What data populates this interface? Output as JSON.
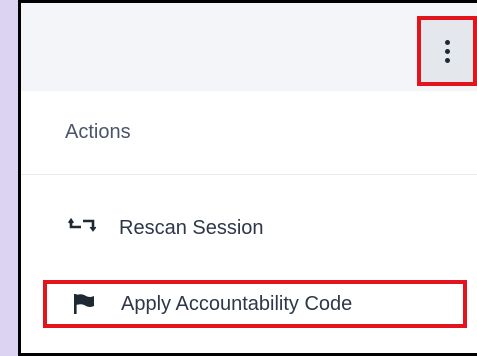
{
  "menu": {
    "header": "Actions",
    "items": [
      {
        "label": "Rescan Session",
        "icon": "repeat-icon"
      },
      {
        "label": "Apply Accountability Code",
        "icon": "flag-icon"
      }
    ]
  },
  "more_button": {
    "icon": "more-vertical-icon"
  },
  "colors": {
    "highlight": "#e3141c",
    "background": "#dcd3f3",
    "text": "#2d3748"
  }
}
